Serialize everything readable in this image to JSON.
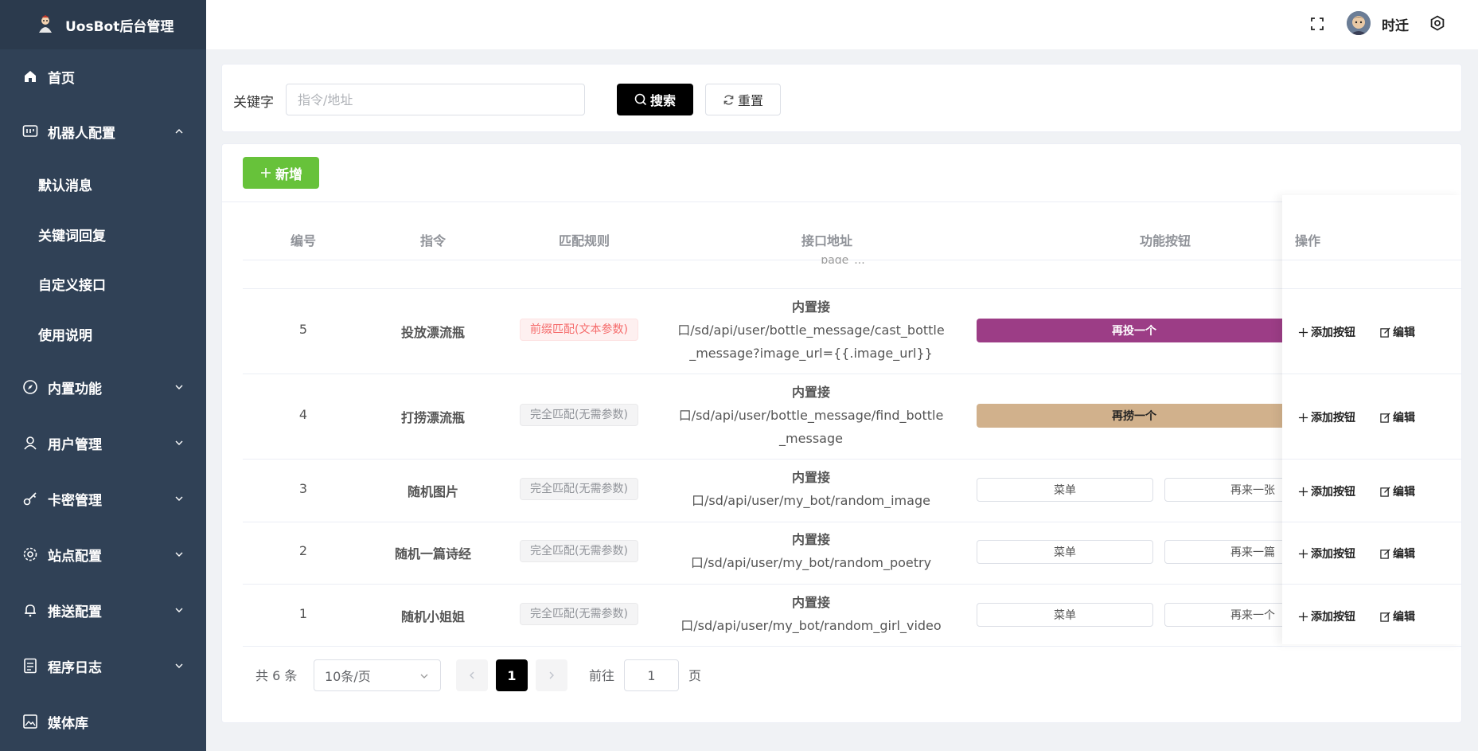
{
  "app": {
    "title": "UosBot后台管理"
  },
  "sidebar": {
    "items": [
      {
        "label": "首页",
        "icon": "home-icon"
      },
      {
        "label": "机器人配置",
        "icon": "robot-config-icon",
        "expanded": true,
        "children": [
          {
            "label": "默认消息"
          },
          {
            "label": "关键词回复"
          },
          {
            "label": "自定义接口"
          },
          {
            "label": "使用说明"
          }
        ]
      },
      {
        "label": "内置功能",
        "icon": "compass-icon"
      },
      {
        "label": "用户管理",
        "icon": "user-icon"
      },
      {
        "label": "卡密管理",
        "icon": "key-icon"
      },
      {
        "label": "站点配置",
        "icon": "gear-icon"
      },
      {
        "label": "推送配置",
        "icon": "bell-icon"
      },
      {
        "label": "程序日志",
        "icon": "document-icon"
      },
      {
        "label": "媒体库",
        "icon": "picture-icon"
      }
    ]
  },
  "header": {
    "username": "时迁"
  },
  "search": {
    "label": "关键字",
    "placeholder": "指令/地址",
    "search_btn": "搜索",
    "reset_btn": "重置"
  },
  "toolbar": {
    "add_btn": "新增"
  },
  "table": {
    "headers": [
      "编号",
      "指令",
      "匹配规则",
      "接口地址",
      "功能按钮",
      "操作"
    ],
    "partial_row_text": "page_...",
    "rows": [
      {
        "id": "5",
        "cmd": "投放漂流瓶",
        "rule": "前缀匹配(文本参数)",
        "rule_type": "red",
        "api_title": "内置接",
        "api_path": "口/sd/api/user/bottle_message/cast_bottle_message?image_url={{.image_url}}",
        "buttons": [
          {
            "label": "再投一个",
            "color": "#9c3d86"
          }
        ]
      },
      {
        "id": "4",
        "cmd": "打捞漂流瓶",
        "rule": "完全匹配(无需参数)",
        "rule_type": "gray",
        "api_title": "内置接",
        "api_path": "口/sd/api/user/bottle_message/find_bottle_message",
        "buttons": [
          {
            "label": "再捞一个",
            "color": "#d1b18c"
          }
        ]
      },
      {
        "id": "3",
        "cmd": "随机图片",
        "rule": "完全匹配(无需参数)",
        "rule_type": "gray",
        "api_title": "内置接",
        "api_path": "口/sd/api/user/my_bot/random_image",
        "buttons": [
          {
            "label": "菜单"
          },
          {
            "label": "再来一张"
          }
        ]
      },
      {
        "id": "2",
        "cmd": "随机一篇诗经",
        "rule": "完全匹配(无需参数)",
        "rule_type": "gray",
        "api_title": "内置接",
        "api_path": "口/sd/api/user/my_bot/random_poetry",
        "buttons": [
          {
            "label": "菜单"
          },
          {
            "label": "再来一篇"
          }
        ]
      },
      {
        "id": "1",
        "cmd": "随机小姐姐",
        "rule": "完全匹配(无需参数)",
        "rule_type": "gray",
        "api_title": "内置接",
        "api_path": "口/sd/api/user/my_bot/random_girl_video",
        "buttons": [
          {
            "label": "菜单"
          },
          {
            "label": "再来一个"
          }
        ]
      }
    ],
    "ops": {
      "add_button": "添加按钮",
      "edit": "编辑"
    }
  },
  "pagination": {
    "total": "共 6 条",
    "page_size": "10条/页",
    "current": "1",
    "goto_label": "前往",
    "goto_value": "1",
    "page_suffix": "页"
  },
  "colors": {
    "sidebar_bg": "#304156",
    "accent": "#000000",
    "success": "#67c23a"
  }
}
